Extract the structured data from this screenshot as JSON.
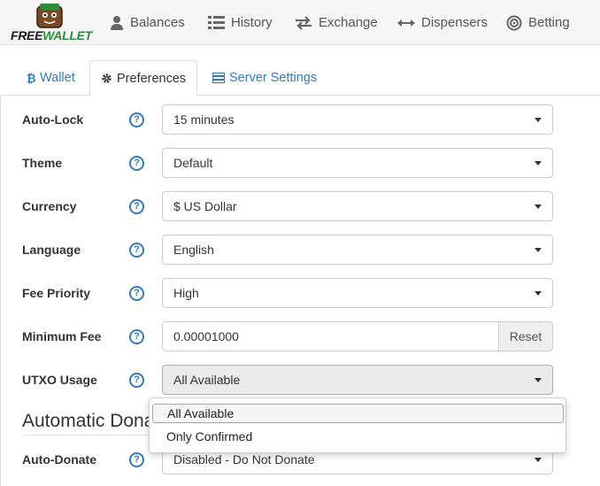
{
  "app": {
    "logo": {
      "free": "FREE",
      "wallet": "WALLET"
    }
  },
  "nav": {
    "items": [
      {
        "label": "Balances",
        "icon": "user-icon"
      },
      {
        "label": "History",
        "icon": "list-icon"
      },
      {
        "label": "Exchange",
        "icon": "exchange-icon"
      },
      {
        "label": "Dispensers",
        "icon": "arrows-horizontal-icon"
      },
      {
        "label": "Betting",
        "icon": "target-icon"
      }
    ]
  },
  "tabs": [
    {
      "label": "Wallet",
      "icon": "bitcoin-icon",
      "active": false
    },
    {
      "label": "Preferences",
      "icon": "gear-icon",
      "active": true
    },
    {
      "label": "Server Settings",
      "icon": "server-icon",
      "active": false
    }
  ],
  "form": {
    "help_glyph": "?",
    "auto_lock": {
      "label": "Auto-Lock",
      "value": "15 minutes"
    },
    "theme": {
      "label": "Theme",
      "value": "Default"
    },
    "currency": {
      "label": "Currency",
      "value": "$ US Dollar"
    },
    "language": {
      "label": "Language",
      "value": "English"
    },
    "fee_priority": {
      "label": "Fee Priority",
      "value": "High"
    },
    "minimum_fee": {
      "label": "Minimum Fee",
      "value": "0.00001000",
      "reset_label": "Reset"
    },
    "utxo_usage": {
      "label": "UTXO Usage",
      "value": "All Available",
      "options": [
        "All Available",
        "Only Confirmed"
      ]
    },
    "section_title": "Automatic Donations",
    "auto_donate": {
      "label": "Auto-Donate",
      "value": "Disabled - Do Not Donate"
    }
  },
  "colors": {
    "link": "#337ab7",
    "brand_green": "#2f8a3a"
  }
}
